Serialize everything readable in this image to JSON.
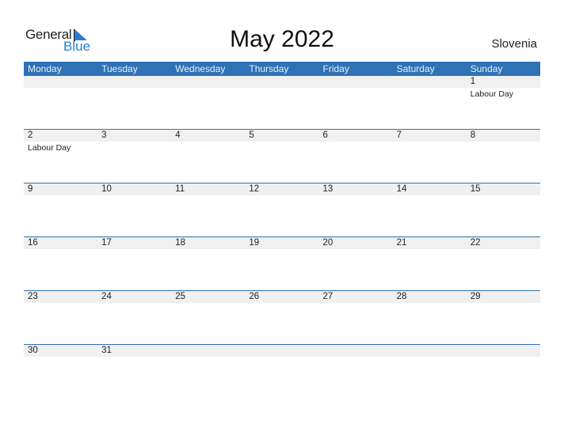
{
  "logo": {
    "general": "General",
    "blue": "Blue"
  },
  "title": "May 2022",
  "country": "Slovenia",
  "colors": {
    "header_bg": "#2f72b5",
    "logo_blue": "#2b7bd2",
    "band": "#f0f0f0"
  },
  "weekdays": [
    "Monday",
    "Tuesday",
    "Wednesday",
    "Thursday",
    "Friday",
    "Saturday",
    "Sunday"
  ],
  "weeks": [
    [
      {
        "d": ""
      },
      {
        "d": ""
      },
      {
        "d": ""
      },
      {
        "d": ""
      },
      {
        "d": ""
      },
      {
        "d": ""
      },
      {
        "d": "1",
        "e": "Labour Day"
      }
    ],
    [
      {
        "d": "2",
        "e": "Labour Day"
      },
      {
        "d": "3"
      },
      {
        "d": "4"
      },
      {
        "d": "5"
      },
      {
        "d": "6"
      },
      {
        "d": "7"
      },
      {
        "d": "8"
      }
    ],
    [
      {
        "d": "9"
      },
      {
        "d": "10"
      },
      {
        "d": "11"
      },
      {
        "d": "12"
      },
      {
        "d": "13"
      },
      {
        "d": "14"
      },
      {
        "d": "15"
      }
    ],
    [
      {
        "d": "16"
      },
      {
        "d": "17"
      },
      {
        "d": "18"
      },
      {
        "d": "19"
      },
      {
        "d": "20"
      },
      {
        "d": "21"
      },
      {
        "d": "22"
      }
    ],
    [
      {
        "d": "23"
      },
      {
        "d": "24"
      },
      {
        "d": "25"
      },
      {
        "d": "26"
      },
      {
        "d": "27"
      },
      {
        "d": "28"
      },
      {
        "d": "29"
      }
    ],
    [
      {
        "d": "30"
      },
      {
        "d": "31"
      },
      {
        "d": ""
      },
      {
        "d": ""
      },
      {
        "d": ""
      },
      {
        "d": ""
      },
      {
        "d": ""
      }
    ]
  ]
}
